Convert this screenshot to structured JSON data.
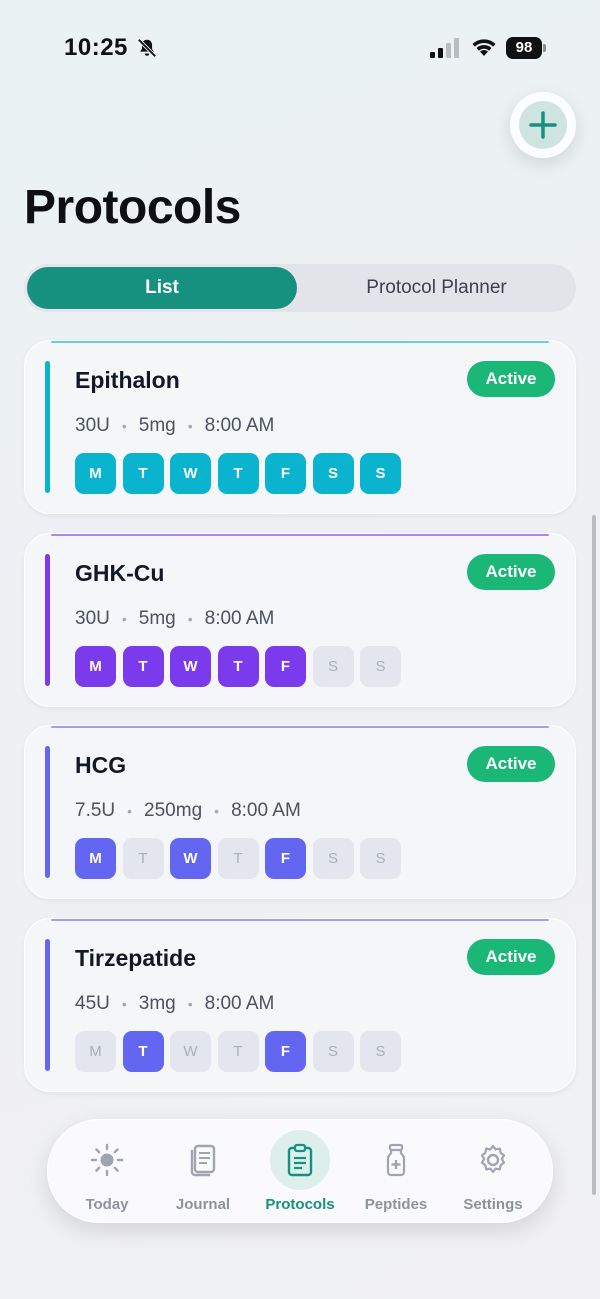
{
  "status_bar": {
    "time": "10:25",
    "battery": "98"
  },
  "header": {
    "title": "Protocols"
  },
  "segmented": {
    "list_label": "List",
    "planner_label": "Protocol Planner"
  },
  "protocols": [
    {
      "name": "Epithalon",
      "status": "Active",
      "dose": "30U",
      "amount": "5mg",
      "time": "8:00 AM",
      "color": "#0ab4cf",
      "days": [
        {
          "l": "M",
          "on": true
        },
        {
          "l": "T",
          "on": true
        },
        {
          "l": "W",
          "on": true
        },
        {
          "l": "T",
          "on": true
        },
        {
          "l": "F",
          "on": true
        },
        {
          "l": "S",
          "on": true
        },
        {
          "l": "S",
          "on": true
        }
      ]
    },
    {
      "name": "GHK-Cu",
      "status": "Active",
      "dose": "30U",
      "amount": "5mg",
      "time": "8:00 AM",
      "color": "#7c3aed",
      "days": [
        {
          "l": "M",
          "on": true
        },
        {
          "l": "T",
          "on": true
        },
        {
          "l": "W",
          "on": true
        },
        {
          "l": "T",
          "on": true
        },
        {
          "l": "F",
          "on": true
        },
        {
          "l": "S",
          "on": false
        },
        {
          "l": "S",
          "on": false
        }
      ]
    },
    {
      "name": "HCG",
      "status": "Active",
      "dose": "7.5U",
      "amount": "250mg",
      "time": "8:00 AM",
      "color": "#6366f1",
      "days": [
        {
          "l": "M",
          "on": true
        },
        {
          "l": "T",
          "on": false
        },
        {
          "l": "W",
          "on": true
        },
        {
          "l": "T",
          "on": false
        },
        {
          "l": "F",
          "on": true
        },
        {
          "l": "S",
          "on": false
        },
        {
          "l": "S",
          "on": false
        }
      ]
    },
    {
      "name": "Tirzepatide",
      "status": "Active",
      "dose": "45U",
      "amount": "3mg",
      "time": "8:00 AM",
      "color": "#6366f1",
      "days": [
        {
          "l": "M",
          "on": false
        },
        {
          "l": "T",
          "on": true
        },
        {
          "l": "W",
          "on": false
        },
        {
          "l": "T",
          "on": false
        },
        {
          "l": "F",
          "on": true
        },
        {
          "l": "S",
          "on": false
        },
        {
          "l": "S",
          "on": false
        }
      ]
    }
  ],
  "tabs": [
    {
      "label": "Today",
      "icon": "sun-icon"
    },
    {
      "label": "Journal",
      "icon": "journal-icon"
    },
    {
      "label": "Protocols",
      "icon": "clipboard-icon",
      "active": true
    },
    {
      "label": "Peptides",
      "icon": "vial-icon"
    },
    {
      "label": "Settings",
      "icon": "gear-icon"
    }
  ],
  "colors": {
    "accent": "#16907f",
    "badge": "#1ab777"
  }
}
